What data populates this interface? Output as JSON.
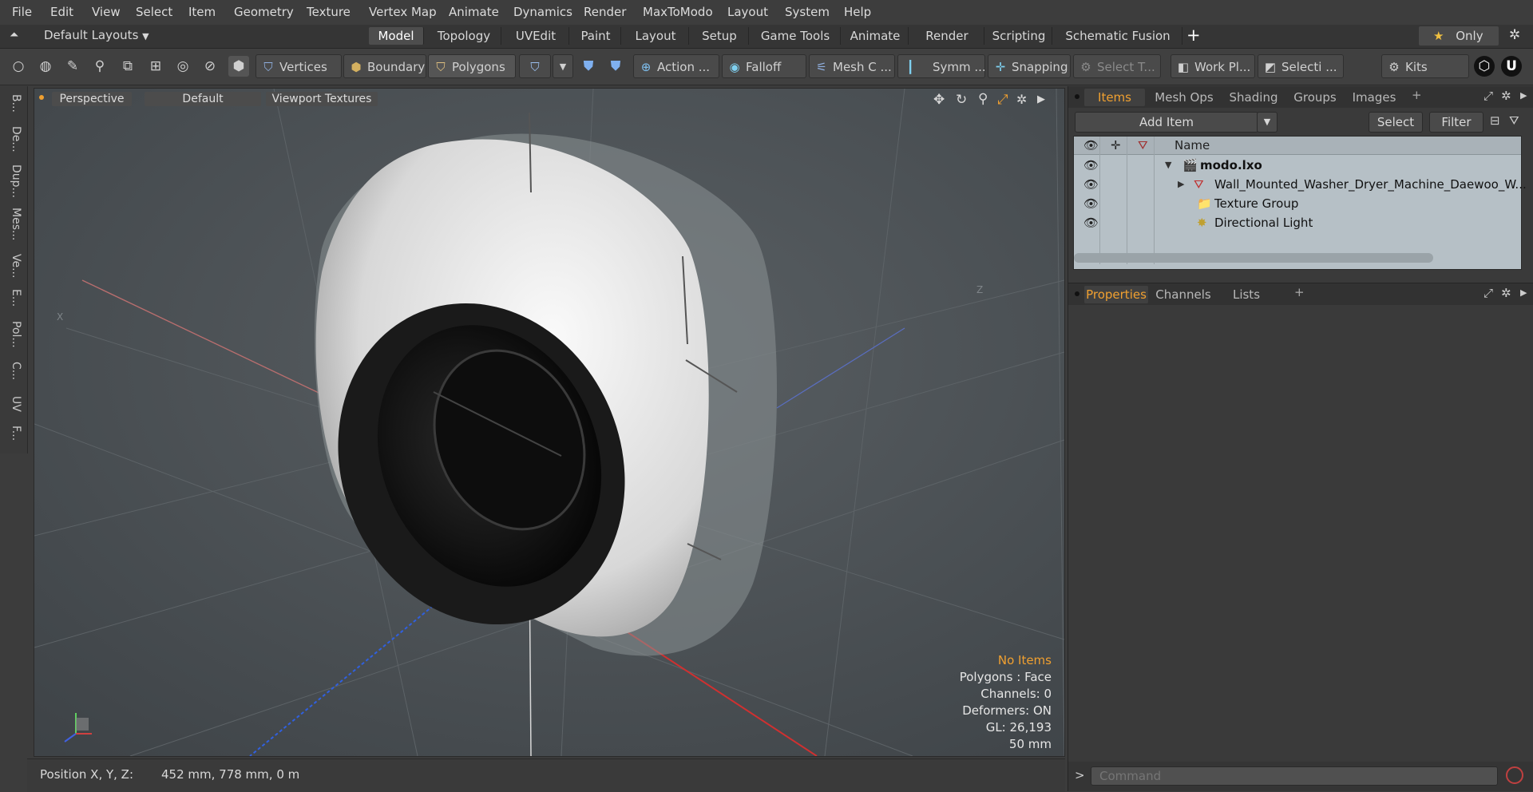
{
  "menu": [
    "File",
    "Edit",
    "View",
    "Select",
    "Item",
    "Geometry",
    "Texture",
    "Vertex Map",
    "Animate",
    "Dynamics",
    "Render",
    "MaxToModo",
    "Layout",
    "System",
    "Help"
  ],
  "layout_bar": {
    "layouts_label": "Default Layouts",
    "tabs": [
      "Model",
      "Topology",
      "UVEdit",
      "Paint",
      "Layout",
      "Setup",
      "Game Tools",
      "Animate",
      "Render",
      "Scripting",
      "Schematic Fusion"
    ],
    "active_tab": "Model",
    "add_symbol": "+",
    "only_label": "Only"
  },
  "toolbar": {
    "vertices": "Vertices",
    "boundary": "Boundary",
    "polygons": "Polygons",
    "action": "Action",
    "action_more": "...",
    "falloff": "Falloff",
    "mesh": "Mesh C ...",
    "symmetry": "Symm ...",
    "snapping": "Snapping",
    "select_t": "Select T...",
    "work_plane": "Work Pl...",
    "selection": "Selecti ...",
    "kits": "Kits"
  },
  "left_tabs": [
    "B...",
    "De...",
    "Dup...",
    "Mes...",
    "Ve...",
    "E...",
    "Pol...",
    "C...",
    "UV",
    "F..."
  ],
  "viewport": {
    "perspective": "Perspective",
    "default": "Default",
    "textures": "Viewport Textures",
    "axis_x": "X",
    "axis_z": "Z",
    "info": [
      "No Items",
      "Polygons : Face",
      "Channels: 0",
      "Deformers: ON",
      "GL: 26,193",
      "50 mm"
    ]
  },
  "status": {
    "position_label": "Position X, Y, Z:",
    "position_value": "452 mm, 778 mm, 0 m"
  },
  "items_panel": {
    "tabs": [
      "Items",
      "Mesh Ops",
      "Shading",
      "Groups",
      "Images"
    ],
    "active_tab": "Items",
    "add_item": "Add Item",
    "select": "Select",
    "filter": "Filter",
    "column_name": "Name",
    "rows": [
      {
        "label": "modo.lxo",
        "bold": true
      },
      {
        "label": "Wall_Mounted_Washer_Dryer_Machine_Daewoo_W...",
        "bold": false
      },
      {
        "label": "Texture Group",
        "bold": false
      },
      {
        "label": "Directional Light",
        "bold": false
      }
    ]
  },
  "properties_panel": {
    "tabs": [
      "Properties",
      "Channels",
      "Lists"
    ],
    "active_tab": "Properties"
  },
  "command": {
    "placeholder": "Command",
    "prompt": ">"
  },
  "colors": {
    "accent": "#f0a030",
    "viewport_bg": "#4a5055",
    "tree_bg": "#b6c0c6"
  }
}
